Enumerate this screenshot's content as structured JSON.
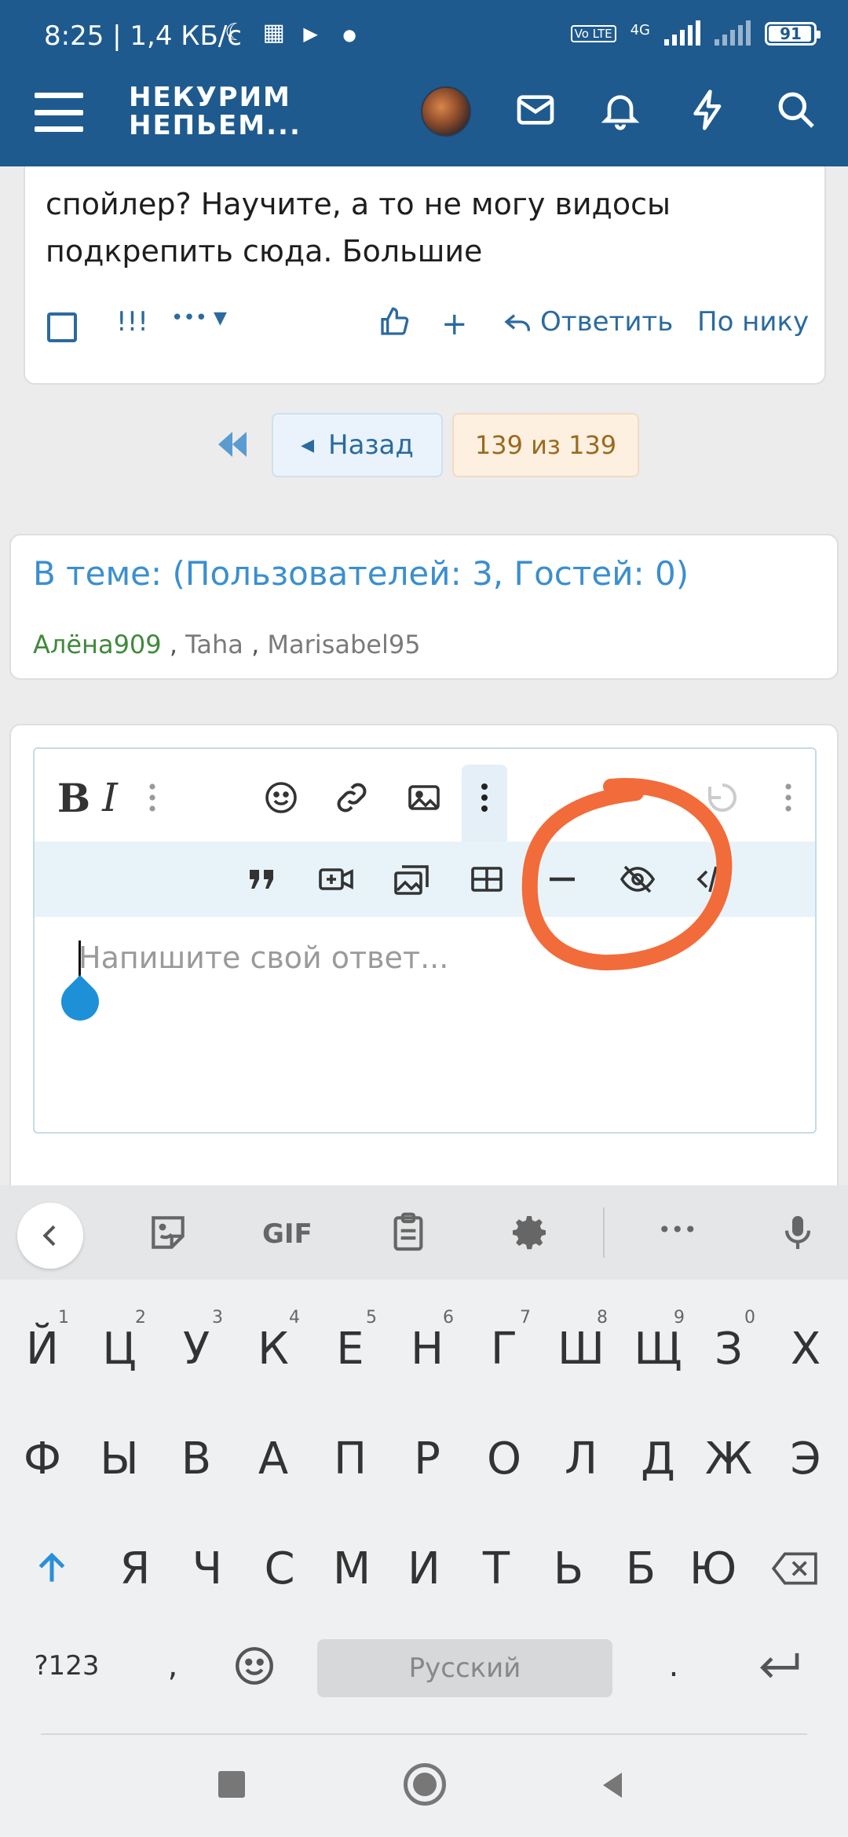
{
  "status_bar": {
    "time": "8:25 | 1,4 КБ/с",
    "network_badge": "Vo LTE",
    "network_type": "4G",
    "battery": "91"
  },
  "header": {
    "logo_line1": "НЕКУРИМ",
    "logo_line2": "НЕПЬЕМ..."
  },
  "post": {
    "text_line1": "спойлер? Научите, а то не могу видосы",
    "text_line2": "подкрепить сюда. Большие",
    "actions": {
      "exclaim": "!!!",
      "more": "•••",
      "plus": "+",
      "reply": "Ответить",
      "by_nick": "По нику"
    }
  },
  "pagination": {
    "back_label": "Назад",
    "page_label": "139 из 139"
  },
  "online": {
    "title": "В теме: (Пользователей: 3, Гостей: 0)",
    "users": [
      "Алёна909",
      "Taha",
      "Marisabel95"
    ],
    "separator": ","
  },
  "editor": {
    "bold": "B",
    "italic": "I",
    "placeholder": "Напишите свой ответ..."
  },
  "keyboard": {
    "toolbar_gif": "GIF",
    "toolbar_more": "•••",
    "row1": [
      {
        "k": "Й",
        "h": "1"
      },
      {
        "k": "Ц",
        "h": "2"
      },
      {
        "k": "У",
        "h": "3"
      },
      {
        "k": "К",
        "h": "4"
      },
      {
        "k": "Е",
        "h": "5"
      },
      {
        "k": "Н",
        "h": "6"
      },
      {
        "k": "Г",
        "h": "7"
      },
      {
        "k": "Ш",
        "h": "8"
      },
      {
        "k": "Щ",
        "h": "9"
      },
      {
        "k": "З",
        "h": "0"
      },
      {
        "k": "Х",
        "h": ""
      }
    ],
    "row2": [
      "Ф",
      "Ы",
      "В",
      "А",
      "П",
      "Р",
      "О",
      "Л",
      "Д",
      "Ж",
      "Э"
    ],
    "row3": [
      "Я",
      "Ч",
      "С",
      "М",
      "И",
      "Т",
      "Ь",
      "Б",
      "Ю"
    ],
    "numbers_key": "?123",
    "comma_key": ",",
    "period_key": ".",
    "space_label": "Русский"
  },
  "colors": {
    "header": "#1e5a8e",
    "link": "#2b6a9e",
    "online_title": "#3a8fd0",
    "annotation": "#f26b3a"
  }
}
